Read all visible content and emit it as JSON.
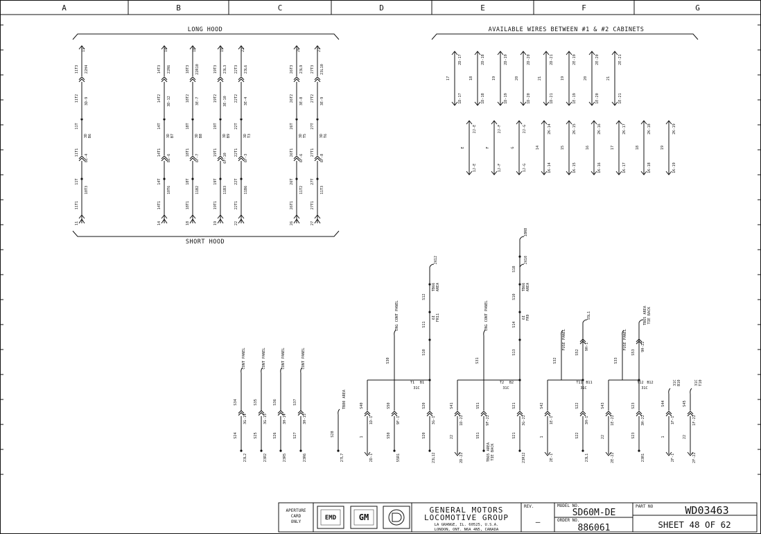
{
  "zones": [
    "A",
    "B",
    "C",
    "D",
    "E",
    "F",
    "G"
  ],
  "long_hood": {
    "title": "LONG HOOD",
    "bottom_title": "SHORT HOOD",
    "columns": [
      {
        "top": "11",
        "t3": "11T3",
        "r3": "22H4",
        "t2": "11T2",
        "c2": "3D-9",
        "t": "11T",
        "c": "3D B6",
        "t1": "11T1",
        "c1": "8E-4",
        "tt": "11T",
        "ct": "10T3",
        "b1": "11T1",
        "bot": "11"
      },
      {
        "top": "14",
        "t3": "14T3",
        "r3": "22R6",
        "t2": "14T2",
        "c2": "3D-12",
        "t": "14T",
        "c": "3D B7",
        "t1": "14T1",
        "c1": "8E-6",
        "tt": "14T",
        "ct": "10T6",
        "b1": "14T1",
        "bot": "14"
      },
      {
        "top": "18",
        "t3": "18T3",
        "r3": "22R10",
        "t2": "18T2",
        "c2": "3E-7",
        "t": "18T",
        "c": "3D B8",
        "t1": "18T1",
        "c1": "6F-7",
        "tt": "18T",
        "ct": "11B2",
        "b1": "18T1",
        "bot": "18"
      },
      {
        "top": "19",
        "t3": "19T3",
        "r3": "23L3",
        "t2": "19T2",
        "c2": "3E-10",
        "t": "19T",
        "c": "3D B9",
        "t1": "19T1",
        "c1": "6F-10",
        "tt": "19T",
        "ct": "11B3",
        "b1": "19T1",
        "bot": "19"
      },
      {
        "top": "22",
        "t3": "22T3",
        "r3": "23L6",
        "t2": "22T2",
        "c2": "3E-4",
        "t": "22T",
        "c": "3D T3",
        "t1": "22T1",
        "c1": "6F-3",
        "tt": "22T",
        "ct": "11B6",
        "b1": "22T1",
        "bot": "22"
      },
      {
        "top": "26",
        "t3": "26T3",
        "r3": "23L9",
        "t2": "26T2",
        "c2": "3E-8",
        "t": "26T",
        "c": "3D T5",
        "t1": "26T1",
        "c1": "6F-6",
        "tt": "26T",
        "ct": "11T2",
        "b1": "26T1",
        "bot": "26"
      },
      {
        "top": "27",
        "t3": "27T3",
        "r3": "23L10",
        "t2": "27T2",
        "c2": "3E-9",
        "t": "27T",
        "c": "3D T6",
        "t1": "27T1",
        "c1": "6F-8",
        "tt": "27T",
        "ct": "11T3",
        "b1": "27T1",
        "bot": "27"
      }
    ]
  },
  "available": {
    "title": "AVAILABLE WIRES BETWEEN #1 & #2 CABINETS",
    "row1": [
      {
        "w": "17",
        "top": "2D-17",
        "bot": "1D-17"
      },
      {
        "w": "18",
        "top": "2D-18",
        "bot": "1D-18"
      },
      {
        "w": "19",
        "top": "2D-19",
        "bot": "1D-19"
      },
      {
        "w": "20",
        "top": "2D-20",
        "bot": "1D-20"
      },
      {
        "w": "21",
        "top": "2D-21",
        "bot": "1D-21"
      },
      {
        "w": "19",
        "top": "2E-19",
        "bot": "1E-19"
      },
      {
        "w": "20",
        "top": "2E-20",
        "bot": "1E-20"
      },
      {
        "w": "21",
        "top": "2E-21",
        "bot": "1E-21"
      }
    ],
    "row2": [
      {
        "w": "E",
        "top": "2J-E",
        "bot": "1J-E"
      },
      {
        "w": "F",
        "top": "2J-F",
        "bot": "1J-F"
      },
      {
        "w": "G",
        "top": "2J-G",
        "bot": "1J-G"
      },
      {
        "w": "14",
        "top": "2K-14",
        "bot": "1K-14"
      },
      {
        "w": "15",
        "top": "2K-15",
        "bot": "1K-15"
      },
      {
        "w": "16",
        "top": "2K-16",
        "bot": "1K-16"
      },
      {
        "w": "17",
        "top": "2K-17",
        "bot": "1K-17"
      },
      {
        "w": "18",
        "top": "2K-18",
        "bot": "1K-18"
      },
      {
        "w": "19",
        "top": "2K-19",
        "bot": "1K-19"
      }
    ]
  },
  "cont_panels": [
    {
      "label": "CONT PANEL",
      "w": "S34",
      "c": "3G-14",
      "lw": "S24",
      "end": "23L2"
    },
    {
      "label": "CONT PANEL",
      "w": "S35",
      "c": "3G-15",
      "lw": "S25",
      "end": "23R2"
    },
    {
      "label": "CONT PANEL",
      "w": "S36",
      "c": "3H-14",
      "lw": "S26",
      "end": "23R5"
    },
    {
      "label": "CONT PANEL",
      "w": "S37",
      "c": "3H-15",
      "lw": "S27",
      "end": "23R6"
    }
  ],
  "tb80": {
    "label": "TB80 AREA",
    "w": "S28",
    "end": "27L7"
  },
  "groups": [
    {
      "panel": "ENG CONT PANEL",
      "w_panel": "S30",
      "term": "T1",
      "bterm": "B1",
      "blk": "31C",
      "left_w": "S40",
      "left_c": "1D-1",
      "left_lw": "1",
      "left_end": "2D-1",
      "mid_w": "S50",
      "mid_c": "9F-1",
      "mid_lw": "S50",
      "mid_end": "55R1",
      "right_w": "S20",
      "right_c": "3G-1",
      "right_lw": "S20",
      "right_end": "23L12",
      "up": [
        {
          "w": "S10"
        },
        {
          "w": "S11",
          "c": "6I FR11"
        },
        {
          "w": "S12",
          "c": "TB66 AREA",
          "end": "JX12"
        }
      ]
    },
    {
      "panel": "ENG CONT PANEL",
      "w_panel": "S31",
      "term": "T2",
      "bterm": "B2",
      "blk": "31C",
      "left_w": "S41",
      "left_c": "1D-22",
      "left_lw": "22",
      "left_end": "2D-22",
      "mid_w": "S51",
      "mid_c": "9F-22",
      "mid_lw": "S51",
      "mid_end": "TB65 AREA TIE BACK",
      "right_w": "S21",
      "right_c": "3G-22",
      "right_lw": "S21",
      "right_end": "23R12",
      "up": [
        {
          "w": "S13"
        },
        {
          "w": "S14",
          "c": "6I FR9"
        },
        {
          "w": "S10",
          "c": "TB66 AREA",
          "end": "JX10"
        },
        {
          "w": "S18",
          "end": "18R8"
        }
      ]
    },
    {
      "panel": "FUSE PANEL",
      "w_panel": "S32",
      "term": "T11",
      "bterm": "B11",
      "blk": "31C",
      "left_w": "S42",
      "left_c": "1E-1",
      "left_lw": "1",
      "left_end": "2E-1",
      "right_w": "S22",
      "right_c": "3H-1",
      "right_lw": "S22",
      "right_end": "23L1",
      "up": [
        {
          "w": "S52",
          "c": "9H-1",
          "end": "55L1"
        }
      ]
    },
    {
      "panel": "FUSE PANEL",
      "w_panel": "S33",
      "term": "T12",
      "bterm": "B12",
      "blk": "31C",
      "left_w": "S43",
      "left_c": "1E-22",
      "left_lw": "22",
      "left_end": "2E-22",
      "right_w": "S23",
      "right_c": "3H-22",
      "right_lw": "S23",
      "right_end": "23R1",
      "up": [
        {
          "w": "S53",
          "c": "9H-22",
          "end": "TB65 AREA TIE BACK"
        }
      ]
    }
  ],
  "singles": [
    {
      "w": "S44",
      "c": "1F-1",
      "lw": "1",
      "end": "2F-1",
      "top": "31C B10"
    },
    {
      "w": "S45",
      "c": "1F-22",
      "lw": "22",
      "end": "2F-22",
      "top": "31C T10"
    }
  ],
  "title_block": {
    "aperture": "APERTURE CARD ONLY",
    "company": "GENERAL MOTORS",
    "group": "LOCOMOTIVE GROUP",
    "addr1": "LA GRANGE, IL. 60525, U.S.A.",
    "addr2": "LONDON, ONT. N6A 4N5, CANADA",
    "rev_label": "REV.",
    "rev_value": "—",
    "model_label": "MODEL NO.",
    "model": "SD60M-DE",
    "order_label": "ORDER NO.",
    "order": "886061",
    "part_label": "PART NO",
    "part": "WD03463",
    "sheet": "SHEET 48 OF 62",
    "logos": [
      "EMD",
      "GM",
      "D"
    ]
  }
}
